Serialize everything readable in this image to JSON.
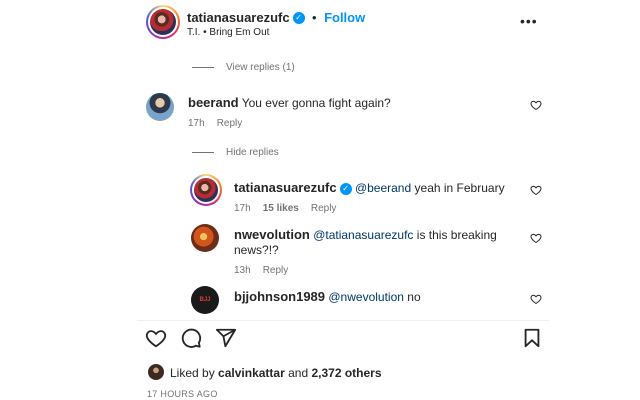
{
  "post": {
    "author": "tatianasuarezufc",
    "follow_label": "Follow",
    "audio": "T.I. • Bring Em Out"
  },
  "thread": {
    "view_replies_label": "View replies (1)",
    "hide_replies_label": "Hide replies"
  },
  "comments": [
    {
      "user": "beerand",
      "text": "You ever gonna fight again?",
      "time": "17h",
      "reply_label": "Reply"
    },
    {
      "user": "tatianasuarezufc",
      "mention": "@beerand",
      "text": "yeah in February",
      "time": "17h",
      "likes": "15 likes",
      "reply_label": "Reply"
    },
    {
      "user": "nwevolution",
      "mention": "@tatianasuarezufc",
      "text": "is this breaking",
      "text2": "news?!?",
      "time": "13h",
      "reply_label": "Reply"
    },
    {
      "user": "bjjohnson1989",
      "mention": "@nwevolution",
      "text": "no",
      "avatar_text": "BJJ"
    }
  ],
  "footer": {
    "liked_by_prefix": "Liked by",
    "liked_by_user": "calvinkattar",
    "liked_by_and": "and",
    "liked_by_others": "2,372 others",
    "timestamp": "17 HOURS AGO"
  },
  "icons": {
    "more": "more-horizontal-icon",
    "heart": "heart-icon",
    "comment": "comment-icon",
    "share": "share-icon",
    "save": "bookmark-icon",
    "verified": "verified-badge-icon"
  },
  "colors": {
    "link_blue": "#0095f6",
    "mention_blue": "#00376b",
    "muted": "#737373",
    "text": "#262626"
  }
}
